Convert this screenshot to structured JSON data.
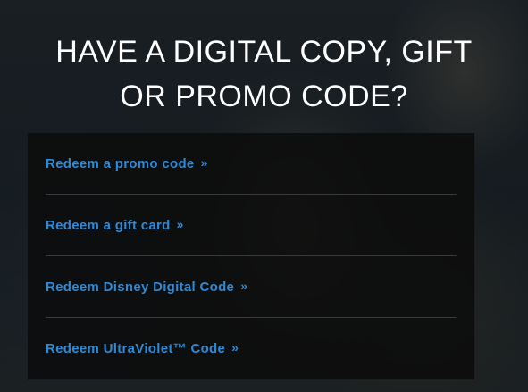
{
  "headline": {
    "line1": "HAVE A DIGITAL COPY, GIFT",
    "line2": "OR PROMO CODE?"
  },
  "links": [
    {
      "label": "Redeem a promo code",
      "icon": "double-chevron-right-icon"
    },
    {
      "label": "Redeem a gift card",
      "icon": "double-chevron-right-icon"
    },
    {
      "label": "Redeem Disney Digital Code",
      "icon": "double-chevron-right-icon"
    },
    {
      "label": "Redeem UltraViolet™ Code",
      "icon": "double-chevron-right-icon"
    }
  ],
  "colors": {
    "link": "#2e8ad6",
    "headline": "#ffffff",
    "panel": "#0c0c0c",
    "divider": "#3a3a3a"
  }
}
